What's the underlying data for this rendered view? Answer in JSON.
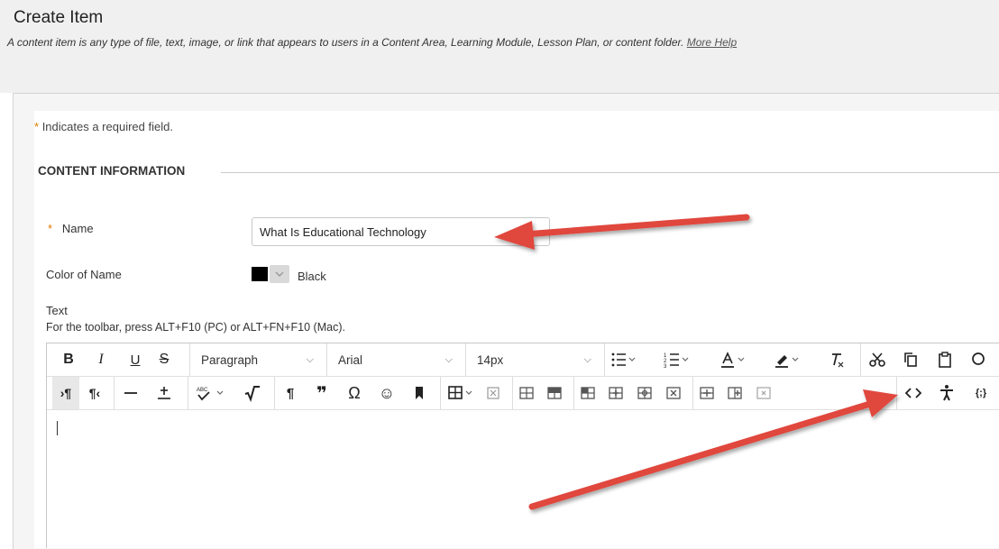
{
  "page": {
    "title": "Create Item",
    "description": "A content item is any type of file, text, image, or link that appears to users in a Content Area, Learning Module, Lesson Plan, or content folder.",
    "more_help": "More Help"
  },
  "form": {
    "required_star": "*",
    "required_note": "Indicates a required field.",
    "section_title": "CONTENT INFORMATION",
    "name_label": "Name",
    "name_value": "What Is Educational Technology",
    "color_label": "Color of Name",
    "color_value": "Black",
    "color_swatch": "#000000",
    "text_label": "Text",
    "toolbar_hint": "For the toolbar, press ALT+F10 (PC) or ALT+FN+F10 (Mac)."
  },
  "toolbar": {
    "bold": "B",
    "italic": "I",
    "underline": "U",
    "strike": "S",
    "paragraph": "Paragraph",
    "font": "Arial",
    "size": "14px"
  },
  "colors": {
    "accent_arrow": "#e0463d",
    "required_star": "#e07b00"
  }
}
